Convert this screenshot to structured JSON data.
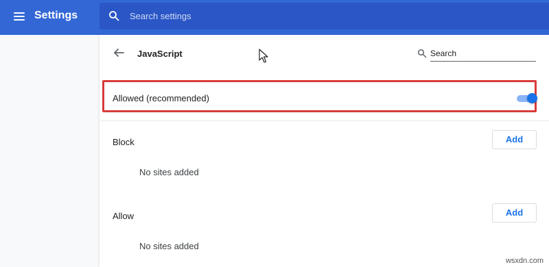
{
  "header": {
    "app_title": "Settings",
    "search_placeholder": "Search settings",
    "bar_color": "#3367d6",
    "menu_icon": "hamburger-menu-icon",
    "search_icon": "search-icon"
  },
  "page": {
    "title": "JavaScript",
    "back_icon": "back-arrow-icon",
    "search_label": "Search",
    "search_icon": "search-icon"
  },
  "allowed_setting": {
    "label": "Allowed (recommended)",
    "enabled": true,
    "highlight_color": "#d93a3a",
    "toggle_color": "#1a73e8"
  },
  "sections": [
    {
      "title": "Block",
      "add_label": "Add",
      "empty_text": "No sites added"
    },
    {
      "title": "Allow",
      "add_label": "Add",
      "empty_text": "No sites added"
    }
  ],
  "watermark": "wsxdn.com"
}
